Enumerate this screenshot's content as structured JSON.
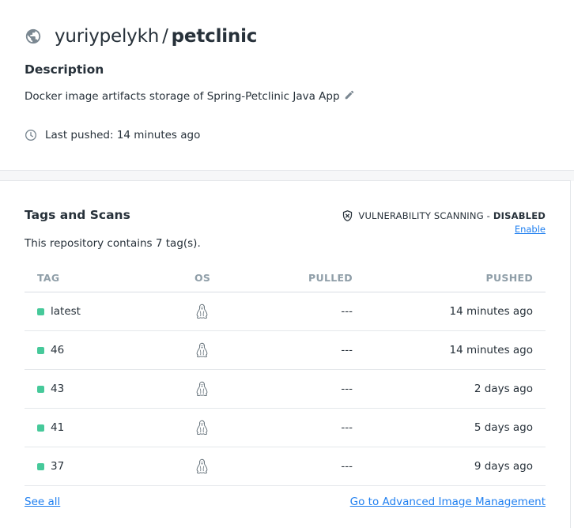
{
  "repo": {
    "namespace": "yuriypelykh",
    "separator": "/",
    "name": "petclinic",
    "visibility_icon": "globe-icon"
  },
  "description": {
    "heading": "Description",
    "text": "Docker image artifacts storage of Spring-Petclinic Java App",
    "edit_icon": "pencil-icon"
  },
  "last_pushed": {
    "icon": "clock-icon",
    "text": "Last pushed: 14 minutes ago"
  },
  "tags_section": {
    "heading": "Tags and Scans",
    "vuln_label": "VULNERABILITY SCANNING",
    "vuln_sep": " - ",
    "vuln_status": "DISABLED",
    "enable_link": "Enable",
    "count_text": "This repository contains 7 tag(s).",
    "columns": [
      "TAG",
      "OS",
      "PULLED",
      "PUSHED"
    ],
    "rows": [
      {
        "tag": "latest",
        "os": "linux",
        "pulled": "---",
        "pushed": "14 minutes ago"
      },
      {
        "tag": "46",
        "os": "linux",
        "pulled": "---",
        "pushed": "14 minutes ago"
      },
      {
        "tag": "43",
        "os": "linux",
        "pulled": "---",
        "pushed": "2 days ago"
      },
      {
        "tag": "41",
        "os": "linux",
        "pulled": "---",
        "pushed": "5 days ago"
      },
      {
        "tag": "37",
        "os": "linux",
        "pulled": "---",
        "pushed": "9 days ago"
      }
    ],
    "see_all": "See all",
    "advanced_link": "Go to Advanced Image Management"
  },
  "colors": {
    "text": "#27313a",
    "muted": "#8f9ea8",
    "link": "#1f7ff0",
    "tag_dot": "#46c99a"
  }
}
